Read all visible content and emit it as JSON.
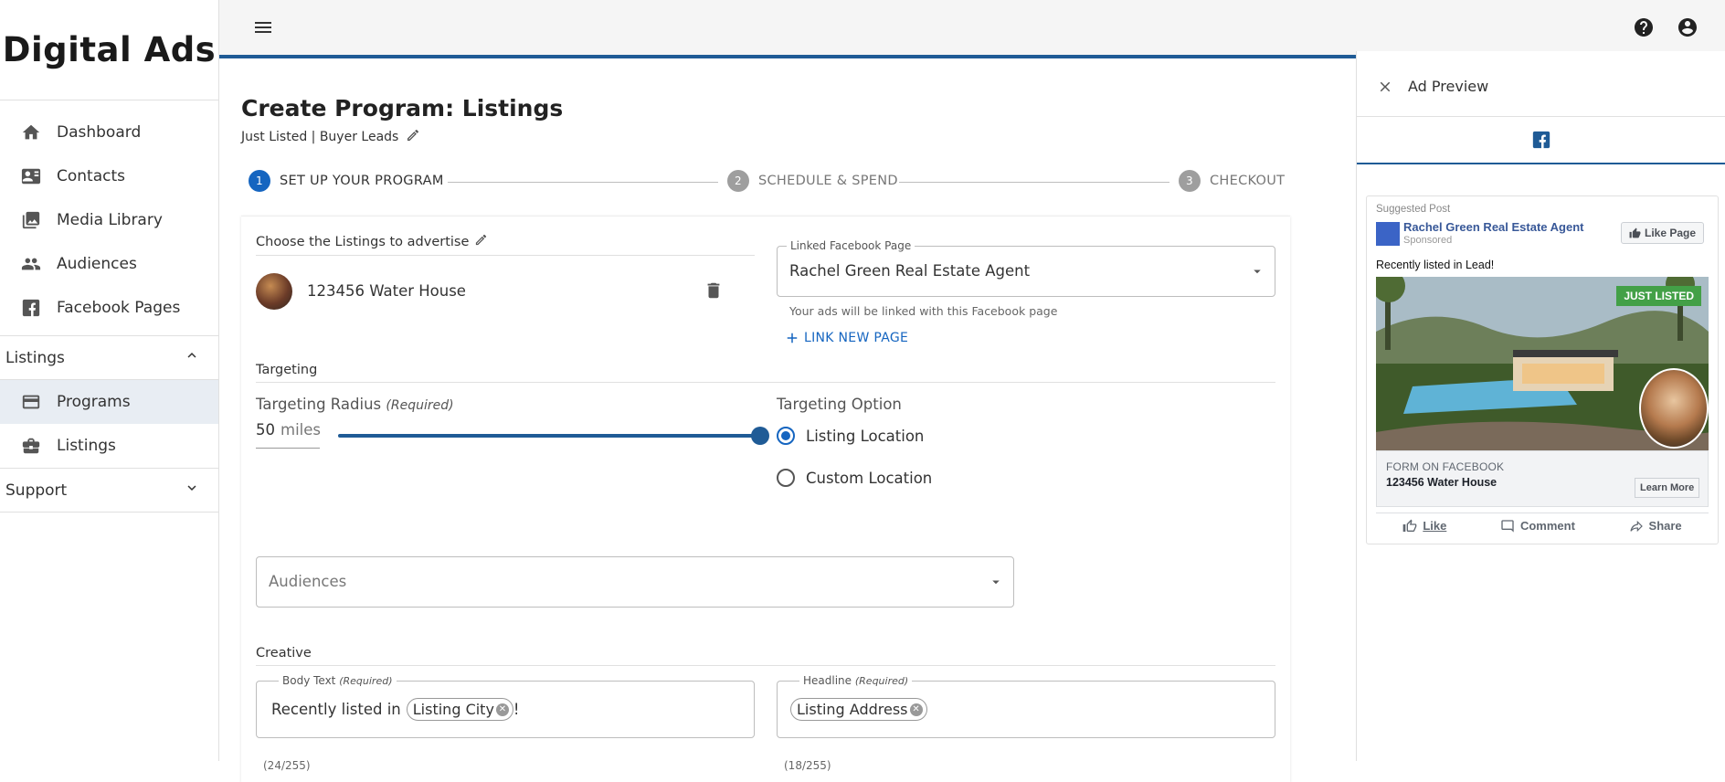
{
  "sidebar": {
    "brand": "Digital Ads",
    "items": [
      {
        "label": "Dashboard",
        "icon": "home-icon"
      },
      {
        "label": "Contacts",
        "icon": "contact-card-icon"
      },
      {
        "label": "Media Library",
        "icon": "photo-library-icon"
      },
      {
        "label": "Audiences",
        "icon": "people-icon"
      },
      {
        "label": "Facebook Pages",
        "icon": "facebook-icon"
      }
    ],
    "groups": {
      "listings": {
        "label": "Listings",
        "expanded": true,
        "children": [
          {
            "label": "Programs",
            "icon": "card-icon",
            "active": true
          },
          {
            "label": "Listings",
            "icon": "briefcase-icon"
          }
        ]
      },
      "support": {
        "label": "Support",
        "expanded": false
      }
    }
  },
  "main": {
    "title": "Create Program: Listings",
    "subtitle": "Just Listed | Buyer Leads",
    "steps": [
      {
        "num": "1",
        "label": "SET UP YOUR PROGRAM",
        "state": "active"
      },
      {
        "num": "2",
        "label": "SCHEDULE & SPEND",
        "state": "inactive"
      },
      {
        "num": "3",
        "label": "CHECKOUT",
        "state": "inactive"
      }
    ],
    "listings_section": {
      "label": "Choose the Listings to advertise",
      "listing_name": "123456 Water House"
    },
    "facebook_page": {
      "legend": "Linked Facebook Page",
      "value": "Rachel Green Real Estate Agent",
      "helper": "Your ads will be linked with this Facebook page",
      "link_new": "LINK NEW PAGE"
    },
    "targeting": {
      "section_label": "Targeting",
      "radius_label": "Targeting Radius",
      "required": "(Required)",
      "radius_value": "50",
      "radius_unit": "miles",
      "slider_fraction": 1.0,
      "option_label": "Targeting Option",
      "options": [
        {
          "label": "Listing Location",
          "checked": true
        },
        {
          "label": "Custom Location",
          "checked": false
        }
      ]
    },
    "audiences": {
      "placeholder": "Audiences"
    },
    "creative": {
      "section_label": "Creative",
      "body": {
        "legend": "Body Text",
        "required": "(Required)",
        "prefix": "Recently listed in",
        "chip": "Listing City",
        "suffix": "!",
        "counter": "(24/255)"
      },
      "headline": {
        "legend": "Headline",
        "required": "(Required)",
        "chip": "Listing Address",
        "counter": "(18/255)"
      }
    }
  },
  "preview": {
    "title": "Ad Preview",
    "tab_icon": "facebook-icon",
    "suggested": "Suggested Post",
    "page_name": "Rachel Green Real Estate Agent",
    "sponsored": "Sponsored",
    "like_page": "Like Page",
    "body": "Recently listed in Lead!",
    "badge": "JUST LISTED",
    "form_label": "FORM ON FACEBOOK",
    "headline": "123456 Water House",
    "cta": "Learn More",
    "actions": [
      "Like",
      "Comment",
      "Share"
    ]
  },
  "colors": {
    "accent": "#1f5b96",
    "primary": "#1565c0",
    "badge": "#43a047"
  }
}
